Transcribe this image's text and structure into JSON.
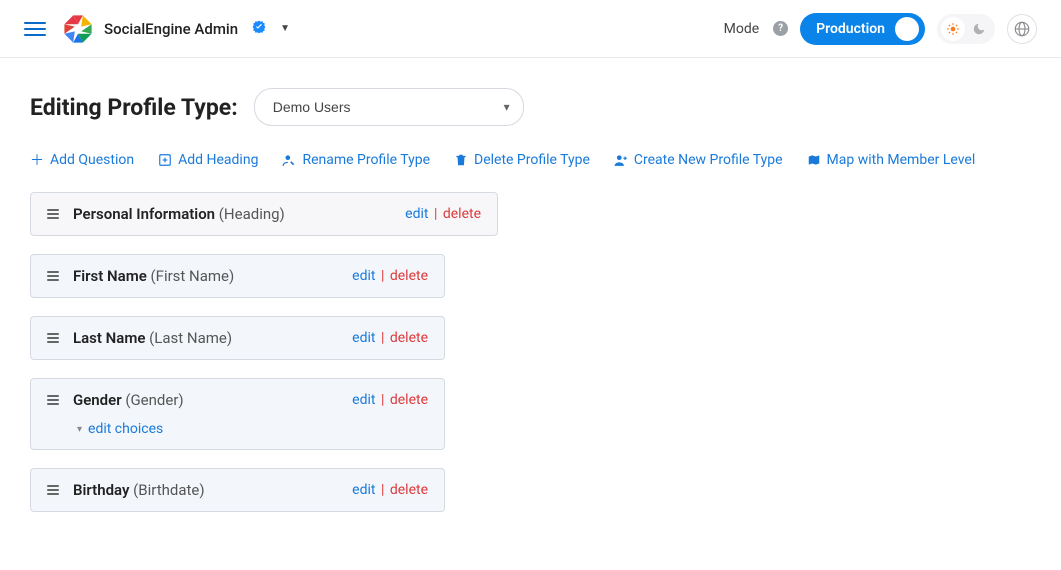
{
  "topbar": {
    "title": "SocialEngine Admin",
    "mode_label": "Mode",
    "mode_value": "Production"
  },
  "page": {
    "heading": "Editing Profile Type:",
    "select_value": "Demo Users"
  },
  "actions": {
    "add_question": "Add Question",
    "add_heading": "Add Heading",
    "rename": "Rename Profile Type",
    "delete_type": "Delete Profile Type",
    "create_new": "Create New Profile Type",
    "map_level": "Map with Member Level"
  },
  "common": {
    "edit": "edit",
    "delete": "delete",
    "edit_choices": "edit choices"
  },
  "fields": [
    {
      "name": "Personal Information",
      "subtype": "(Heading)",
      "kind": "heading",
      "has_choices": false
    },
    {
      "name": "First Name",
      "subtype": "(First Name)",
      "kind": "question",
      "has_choices": false
    },
    {
      "name": "Last Name",
      "subtype": "(Last Name)",
      "kind": "question",
      "has_choices": false
    },
    {
      "name": "Gender",
      "subtype": "(Gender)",
      "kind": "question",
      "has_choices": true
    },
    {
      "name": "Birthday",
      "subtype": "(Birthdate)",
      "kind": "question",
      "has_choices": false
    }
  ]
}
